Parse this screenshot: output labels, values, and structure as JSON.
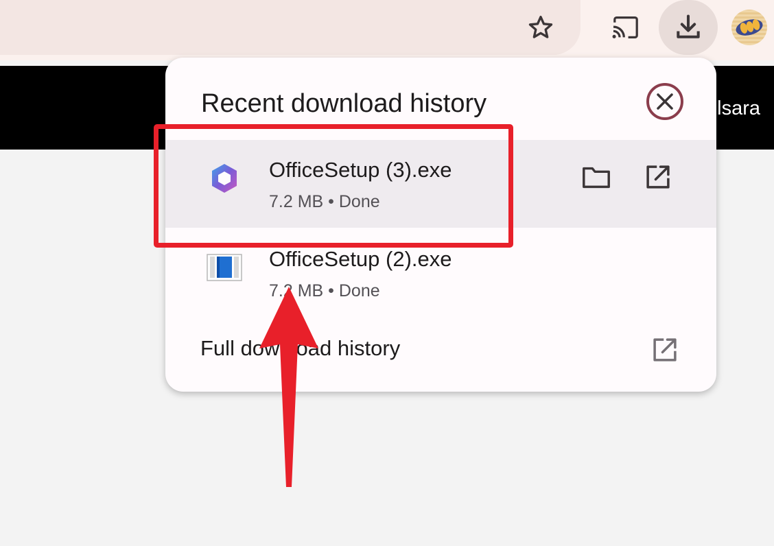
{
  "browser": {
    "toolbar": {
      "bookmark_icon": "star-icon",
      "cast_icon": "cast-icon",
      "download_icon": "download-icon",
      "avatar": "profile-avatar"
    },
    "page_fragment_text": "lsara"
  },
  "downloads_panel": {
    "title": "Recent download history",
    "close_icon": "close-circle-icon",
    "items": [
      {
        "name": "OfficeSetup (3).exe",
        "size": "7.2 MB",
        "separator": "•",
        "status": "Done",
        "icon": "microsoft-365-icon",
        "show_in_folder_icon": "folder-icon",
        "open_icon": "open-external-icon"
      },
      {
        "name": "OfficeSetup (2).exe",
        "size": "7.2 MB",
        "separator": "•",
        "status": "Done",
        "icon": "installer-file-icon"
      }
    ],
    "footer_label": "Full download history",
    "footer_icon": "open-external-icon"
  },
  "annotations": {
    "highlight_color": "#e8202a",
    "arrow_color": "#e8202a"
  }
}
